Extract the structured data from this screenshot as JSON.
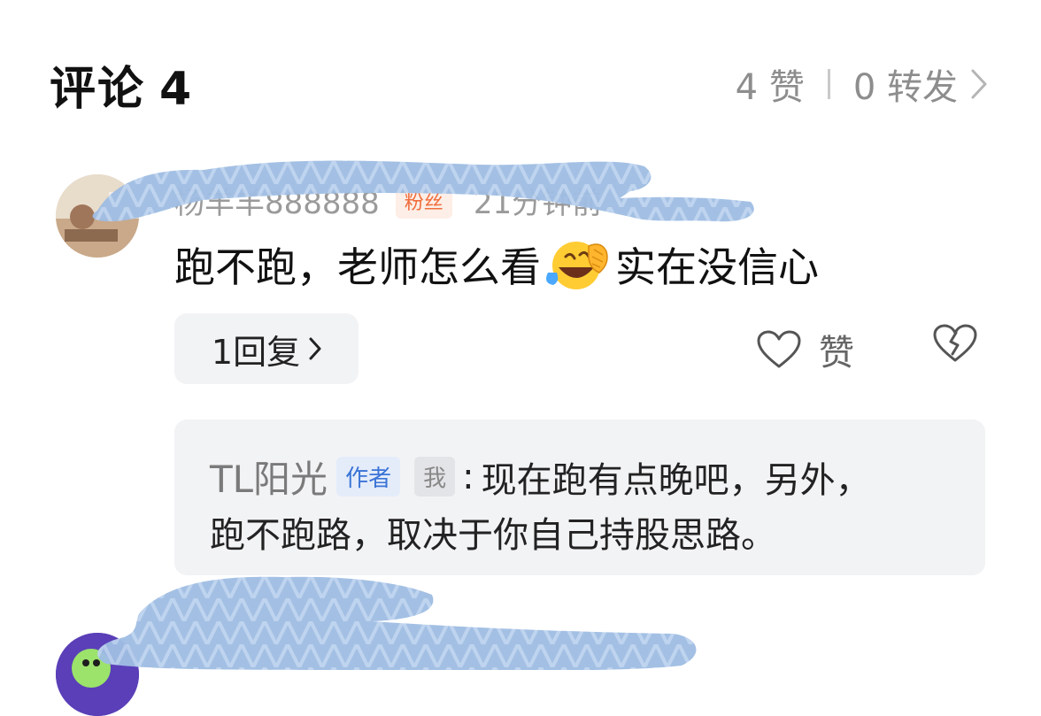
{
  "header": {
    "title": "评论",
    "comment_count": "4",
    "likes": "4 赞",
    "reposts": "0 转发"
  },
  "comment": {
    "username": "杨羊羊888888",
    "badge": "粉丝",
    "time": "21分钟前",
    "text_before": "跑不跑，老师怎么看",
    "emoji": "rolling-laughing-emoji",
    "text_after": "实在没信心",
    "reply_button": "1回复",
    "like_label": "赞"
  },
  "reply": {
    "username": "TL阳光",
    "author_tag": "作者",
    "me_tag": "我",
    "colon": ":",
    "text_line1": "现在跑有点晚吧，另外，",
    "text_line2": "跑不跑路，取决于你自己持股思路。"
  },
  "colors": {
    "redaction": "#9fbde3",
    "muted_text": "#8d8d8d",
    "card_bg": "#f2f3f5",
    "author_tag": "#3a74d6",
    "badge": "#f06d3c"
  }
}
